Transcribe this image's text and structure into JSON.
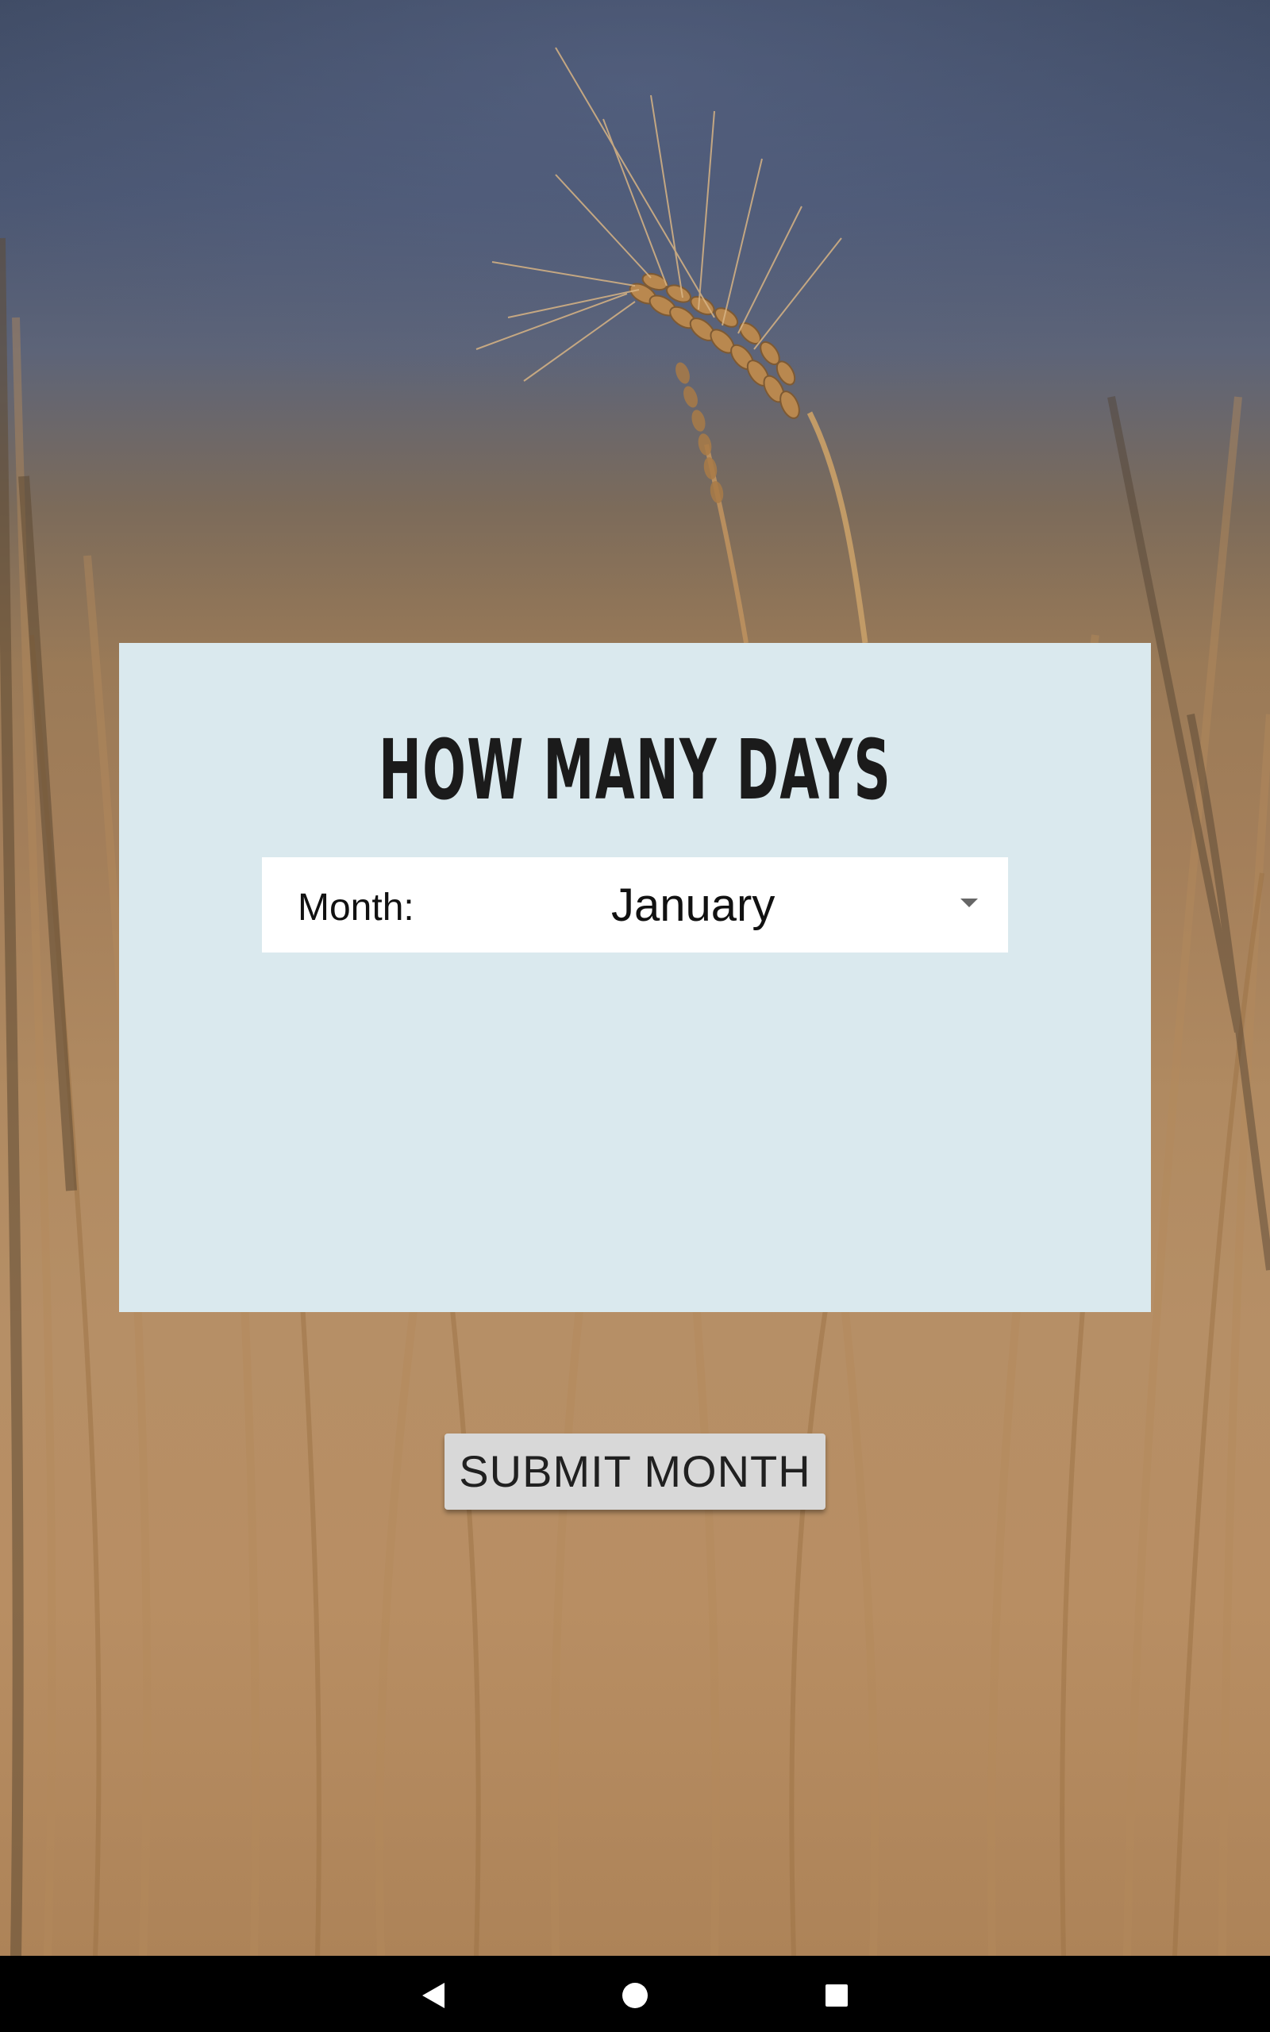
{
  "app": {
    "title": "HOW MANY DAYS"
  },
  "form": {
    "month_label": "Month:",
    "selected_month": "January"
  },
  "actions": {
    "submit_label": "SUBMIT MONTH"
  },
  "navigation": {
    "back_icon": "back-triangle",
    "home_icon": "home-circle",
    "recent_icon": "recent-square"
  },
  "colors": {
    "card_background": "#dae9ee",
    "button_background": "#d8d8d8",
    "navbar_background": "#000000"
  }
}
